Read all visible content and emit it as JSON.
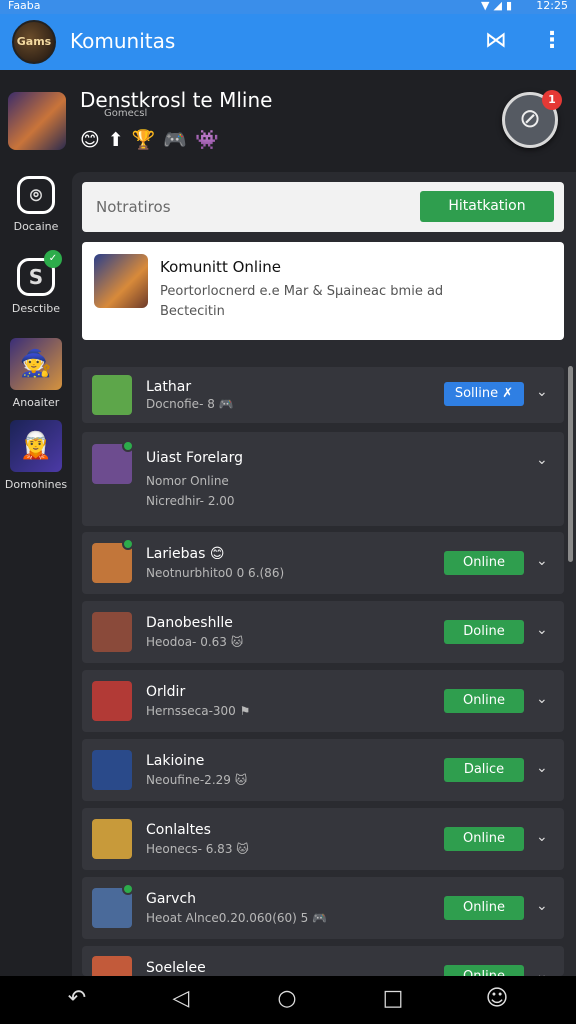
{
  "status_bar": {
    "left_text": "Faaba",
    "time": "12:25",
    "icons": [
      "wifi-icon",
      "signal-icon",
      "battery-icon"
    ]
  },
  "app_bar": {
    "logo_text": "Gams",
    "title": "Komunitas",
    "icons": [
      "share-icon",
      "more-vert-icon"
    ]
  },
  "hero": {
    "title": "Denstkrosl te Mline",
    "subtitle": "Gomecsl",
    "emojis": [
      "😊",
      "⬆",
      "🏆",
      "🎮",
      "👾"
    ],
    "fab_icon": "⊘",
    "fab_badge": "1"
  },
  "sidebar": {
    "items": [
      {
        "label": "Docaine",
        "icon": "discord-icon",
        "glyph": "⌾"
      },
      {
        "label": "Desctibe",
        "icon": "chat-icon",
        "glyph": "S",
        "badge": "✓"
      },
      {
        "label": "Anoaiter",
        "icon": "avatar-wizard-icon",
        "glyph": "🧙"
      },
      {
        "label": "Domohines",
        "icon": "avatar-elf-icon",
        "glyph": "🧝"
      }
    ]
  },
  "search": {
    "placeholder": "Notratiros",
    "button_label": "Hitatkation"
  },
  "info_card": {
    "title": "Komunitt Online",
    "description": "Peortorlocnerd e.e Mar & Sµaineac bmie ad Bectecitin"
  },
  "list": {
    "rows": [
      {
        "name": "Lathar",
        "meta": "Docnofie- 8 🎮",
        "status": "Solline ✗",
        "status_color": "#2f7fe3",
        "thumb": "#5da64a"
      },
      {
        "name": "Uiast Forelarg",
        "meta": "Nomor Online",
        "meta2": "Nicredhir- 2.00",
        "status": "",
        "thumb": "#6d4c8f"
      },
      {
        "name": "Lariebas 😊",
        "meta": "Neotnurbhito0 0 6.(86)",
        "status": "Online",
        "status_color": "#2f9e4e",
        "thumb": "#c2763a"
      },
      {
        "name": "Danobeshlle",
        "meta": "Heodoa- 0.63 🐱",
        "status": "Doline",
        "status_color": "#2f9e4e",
        "thumb": "#8a4a3a"
      },
      {
        "name": "Orldir",
        "meta": "Hernsseca-300 ⚑",
        "status": "Online",
        "status_color": "#2f9e4e",
        "thumb": "#b23a36"
      },
      {
        "name": "Lakioine",
        "meta": "Neoufine-2.29 🐱",
        "status": "Dalice",
        "status_color": "#2f9e4e",
        "thumb": "#2a4a8a"
      },
      {
        "name": "Conlaltes",
        "meta": "Heonecs- 6.83 🐱",
        "status": "Online",
        "status_color": "#2f9e4e",
        "thumb": "#c89a3a"
      },
      {
        "name": "Garvch",
        "meta": "Heoat Alnce0.20.060(60) 5 🎮",
        "status": "Online",
        "status_color": "#2f9e4e",
        "thumb": "#4a6a9a"
      },
      {
        "name": "Soelelee",
        "meta": "",
        "status": "Online",
        "status_color": "#2f9e4e",
        "thumb": "#c25a3a"
      }
    ]
  },
  "nav": {
    "items": [
      {
        "name": "undo-icon",
        "glyph": "↶"
      },
      {
        "name": "back-icon",
        "glyph": "◁"
      },
      {
        "name": "home-icon",
        "glyph": "○"
      },
      {
        "name": "recents-icon",
        "glyph": "□"
      },
      {
        "name": "assistant-icon",
        "glyph": "☺"
      }
    ]
  }
}
